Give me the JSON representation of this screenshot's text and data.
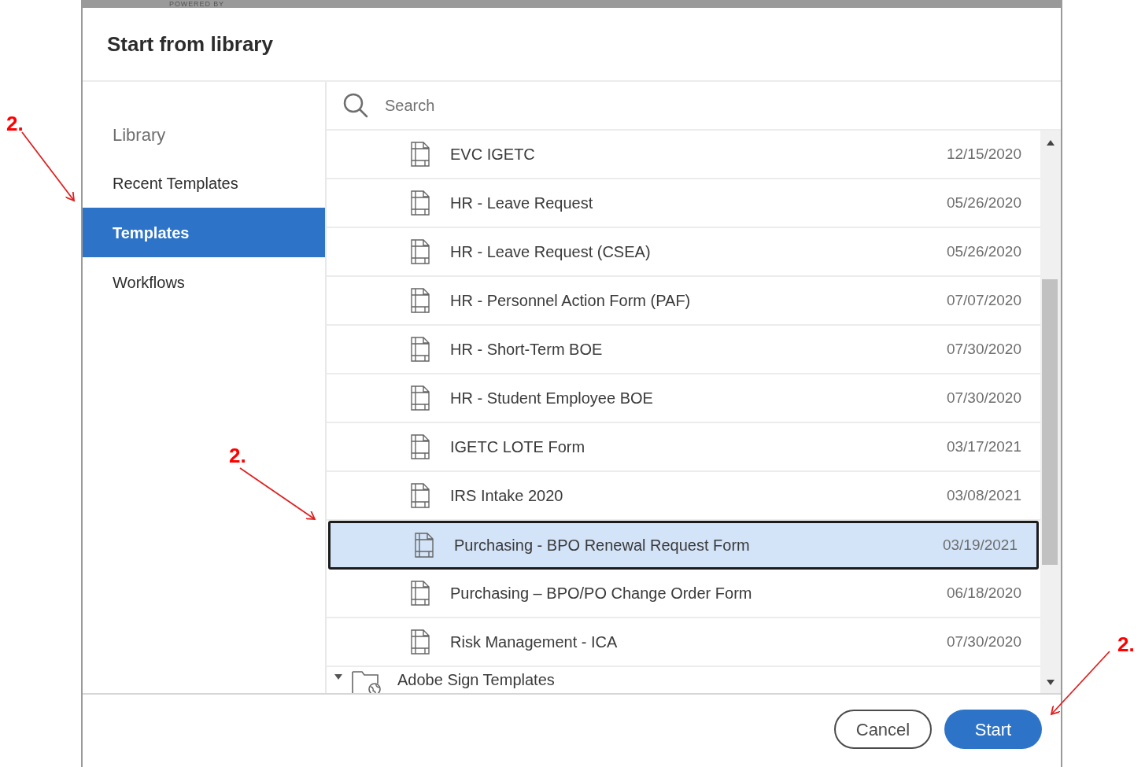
{
  "background": {
    "text": "POWERED BY"
  },
  "dialog": {
    "title": "Start from library",
    "sidebar": {
      "heading": "Library",
      "items": [
        {
          "label": "Recent Templates",
          "selected": false
        },
        {
          "label": "Templates",
          "selected": true
        },
        {
          "label": "Workflows",
          "selected": false
        }
      ]
    },
    "search": {
      "placeholder": "Search"
    },
    "rows": [
      {
        "kind": "template",
        "name": "EVC IGETC",
        "date": "12/15/2020",
        "selected": false
      },
      {
        "kind": "template",
        "name": "HR - Leave Request",
        "date": "05/26/2020",
        "selected": false
      },
      {
        "kind": "template",
        "name": "HR - Leave Request (CSEA)",
        "date": "05/26/2020",
        "selected": false
      },
      {
        "kind": "template",
        "name": "HR - Personnel Action Form (PAF)",
        "date": "07/07/2020",
        "selected": false
      },
      {
        "kind": "template",
        "name": "HR - Short-Term BOE",
        "date": "07/30/2020",
        "selected": false
      },
      {
        "kind": "template",
        "name": "HR - Student Employee BOE",
        "date": "07/30/2020",
        "selected": false
      },
      {
        "kind": "template",
        "name": "IGETC LOTE Form",
        "date": "03/17/2021",
        "selected": false
      },
      {
        "kind": "template",
        "name": "IRS Intake 2020",
        "date": "03/08/2021",
        "selected": false
      },
      {
        "kind": "template",
        "name": "Purchasing - BPO Renewal Request Form",
        "date": "03/19/2021",
        "selected": true
      },
      {
        "kind": "template",
        "name": "Purchasing – BPO/PO Change Order Form",
        "date": "06/18/2020",
        "selected": false
      },
      {
        "kind": "template",
        "name": "Risk Management - ICA",
        "date": "07/30/2020",
        "selected": false
      },
      {
        "kind": "folder",
        "name": "Adobe Sign Templates",
        "expanded": true
      }
    ],
    "buttons": [
      {
        "label": "Cancel",
        "kind": "secondary"
      },
      {
        "label": "Start",
        "kind": "primary"
      }
    ]
  },
  "annotations": [
    {
      "label": "2."
    },
    {
      "label": "2."
    },
    {
      "label": "2."
    }
  ]
}
